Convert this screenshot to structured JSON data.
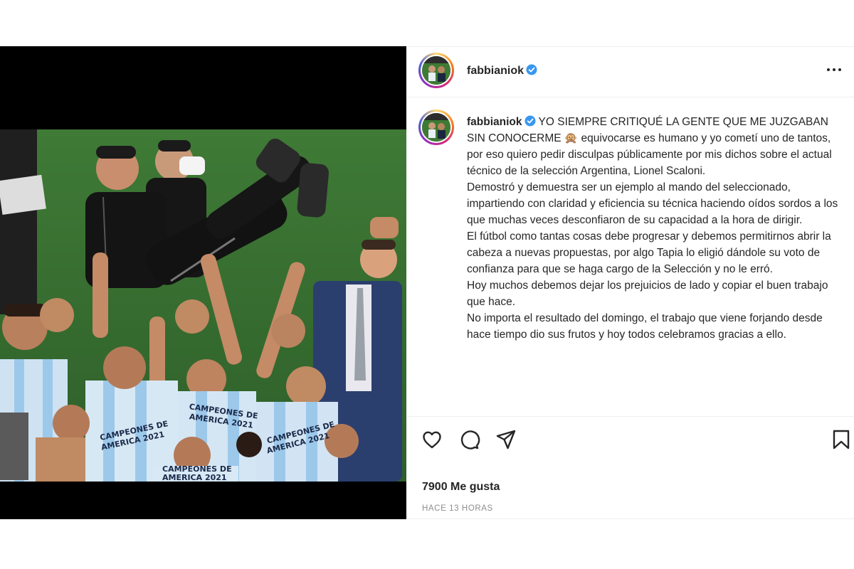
{
  "post": {
    "username": "fabbianiok",
    "verified": true,
    "caption_lines": [
      " YO SIEMPRE CRITIQUÉ LA GENTE QUE ME JUZGABAN SIN CONOCERME 🙊 equivocarse es humano y yo cometí uno de tantos, por eso quiero pedir disculpas públicamente por mis dichos sobre el actual técnico de la selección Argentina, Lionel Scaloni.",
      "Demostró y demuestra ser un ejemplo al mando del seleccionado, impartiendo con claridad y eficiencia su técnica haciendo oídos sordos a los que muchas veces desconfiaron de su capacidad a la hora de dirigir.",
      "El fútbol como tantas cosas debe progresar y debemos permitirnos abrir la cabeza a nuevas propuestas, por algo Tapia lo eligió dándole su voto de confianza para que se haga cargo de la Selección y no le erró.",
      "Hoy muchos debemos dejar los prejuicios de lado y copiar el buen trabajo que hace.",
      "No importa el resultado del domingo, el trabajo que viene forjando desde hace tiempo dio sus frutos y hoy todos celebramos gracias a ello."
    ],
    "likes": "7900 Me gusta",
    "time_ago": "HACE 13 HORAS"
  },
  "photo": {
    "shirt_text_1": "CAMPEONES DE",
    "shirt_text_2": "AMERICA 2021"
  },
  "icons": {
    "more": "more-options-icon",
    "like": "heart-icon",
    "comment": "comment-icon",
    "share": "share-icon",
    "save": "bookmark-icon",
    "verified": "verified-badge-icon"
  },
  "colors": {
    "verified_blue": "#3897f0",
    "text": "#262626",
    "muted": "#8e8e8e",
    "divider": "#efefef"
  }
}
